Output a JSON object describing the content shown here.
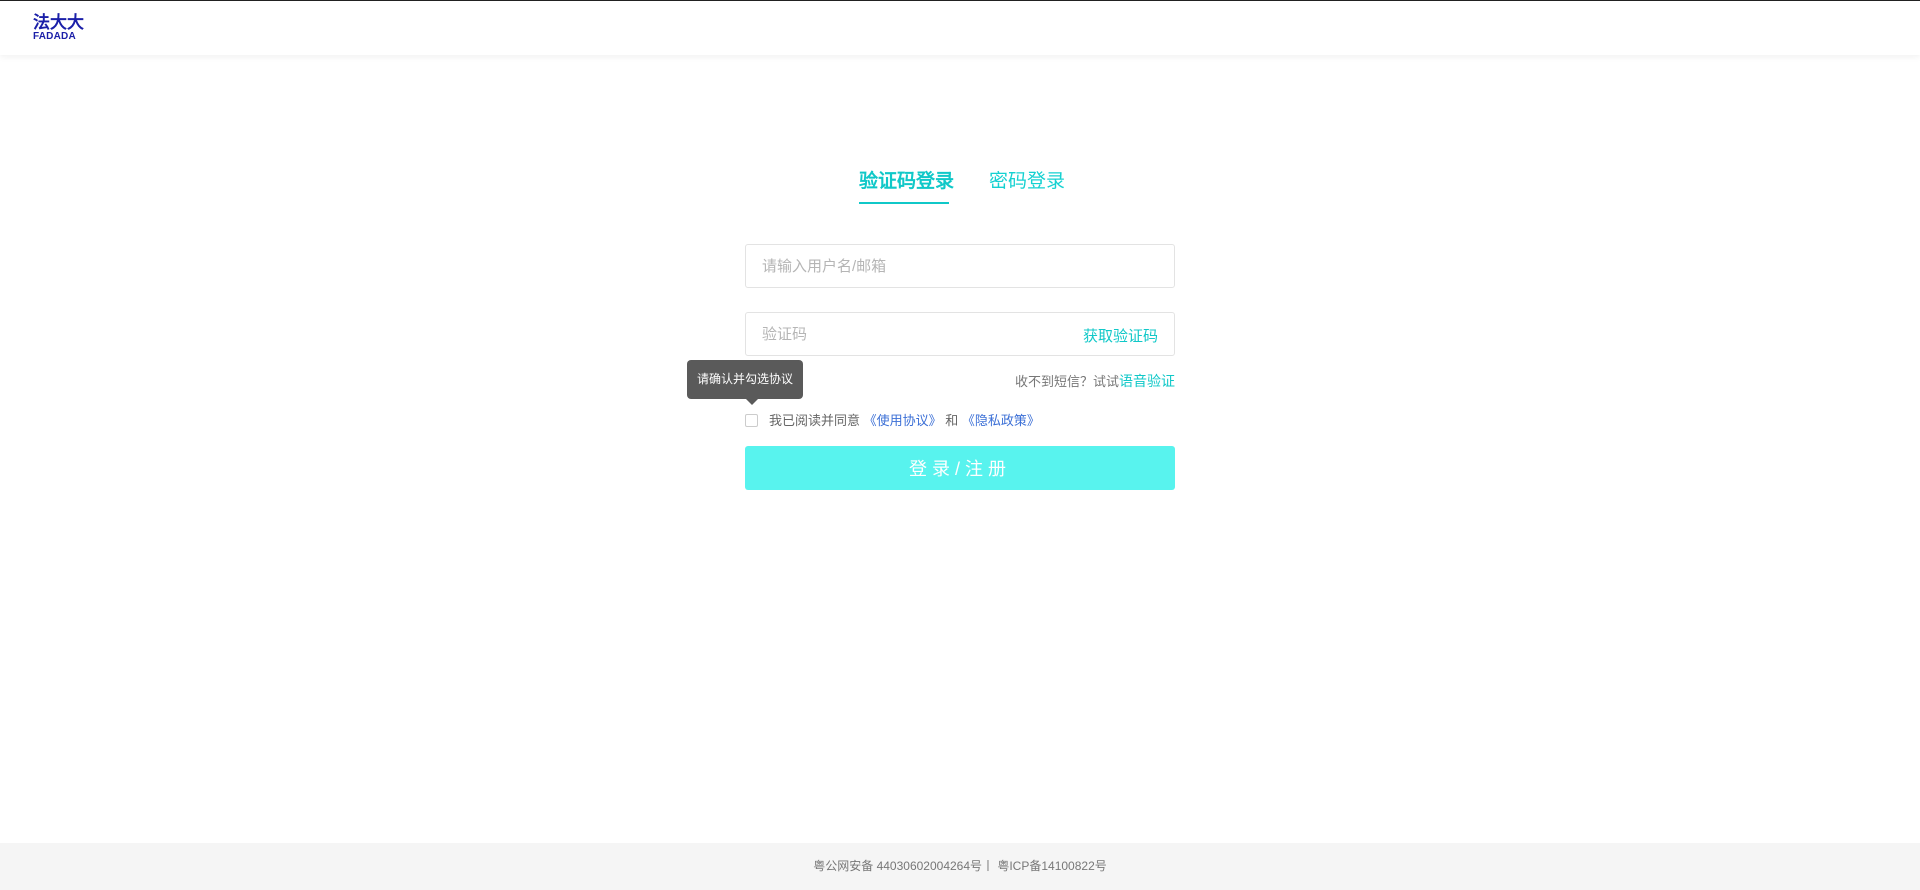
{
  "header": {
    "logo_cn": "法大大",
    "logo_en": "FADADA"
  },
  "tabs": [
    {
      "label": "验证码登录",
      "active": true
    },
    {
      "label": "密码登录",
      "active": false
    }
  ],
  "form": {
    "username_placeholder": "请输入用户名/邮箱",
    "username_value": "",
    "code_placeholder": "验证码",
    "code_value": "",
    "get_code_label": "获取验证码",
    "sms_hint": "收不到短信？试试",
    "voice_label": "语音验证",
    "tooltip": "请确认并勾选协议",
    "agree_prefix": "我已阅读并同意",
    "agree_link1": "《使用协议》",
    "agree_and": "和",
    "agree_link2": "《隐私政策》",
    "agree_checked": false,
    "submit_label": "登录/注册"
  },
  "footer": {
    "text": "粤公网安备 44030602004264号丨 粤ICP备14100822号"
  },
  "colors": {
    "accent": "#10c8c8",
    "button": "#58f3ee",
    "link": "#3b6fd6",
    "logo": "#1a1fa8"
  }
}
